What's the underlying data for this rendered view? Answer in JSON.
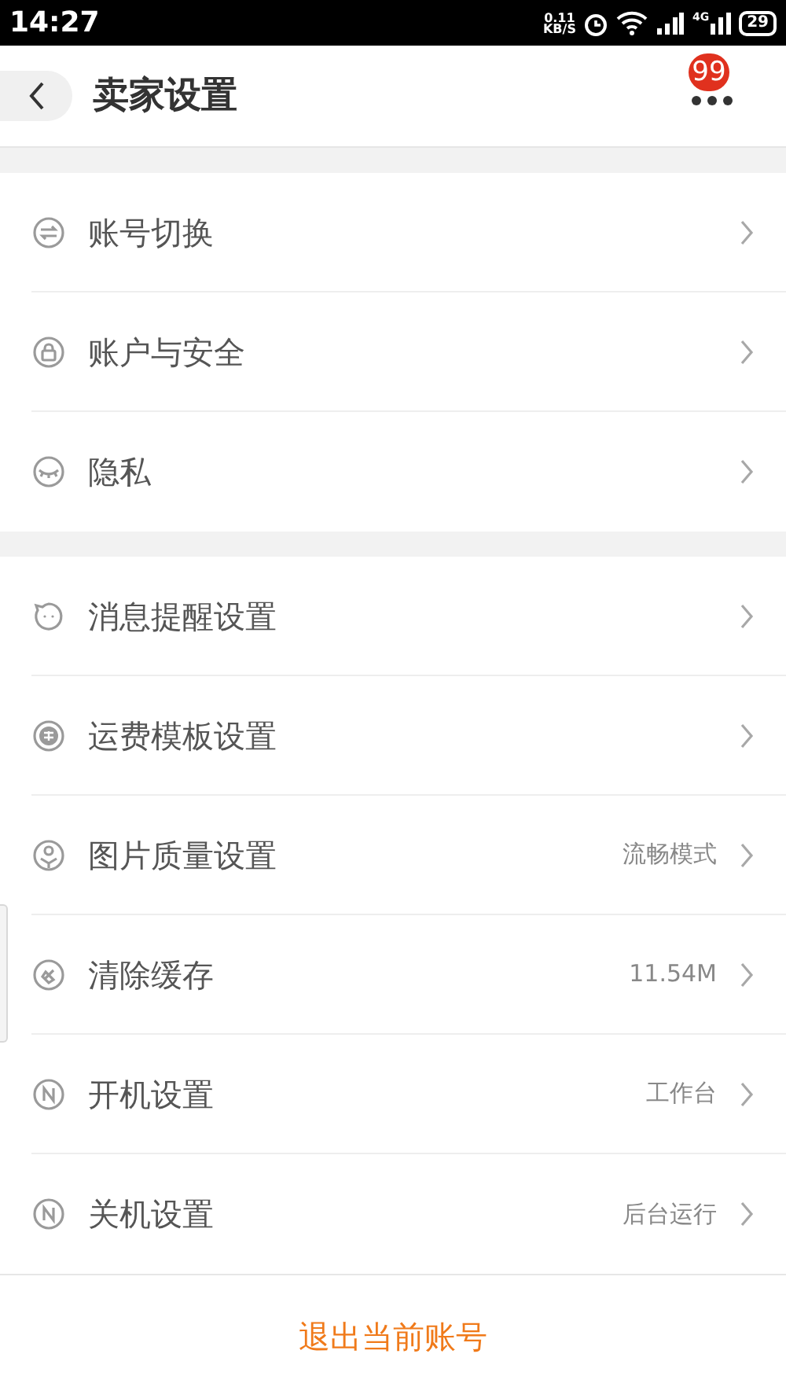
{
  "status_bar": {
    "time": "14:27",
    "speed_value": "0.11",
    "speed_unit": "KB/S",
    "network": "4G",
    "battery": "29"
  },
  "header": {
    "title": "卖家设置",
    "badge": "99"
  },
  "sections": [
    {
      "items": [
        {
          "label": "账号切换"
        },
        {
          "label": "账户与安全"
        },
        {
          "label": "隐私"
        }
      ]
    },
    {
      "items": [
        {
          "label": "消息提醒设置"
        },
        {
          "label": "运费模板设置"
        },
        {
          "label": "图片质量设置",
          "value": "流畅模式"
        },
        {
          "label": "清除缓存",
          "value": "11.54M"
        },
        {
          "label": "开机设置",
          "value": "工作台"
        },
        {
          "label": "关机设置",
          "value": "后台运行"
        }
      ]
    }
  ],
  "logout_button": "退出当前账号"
}
